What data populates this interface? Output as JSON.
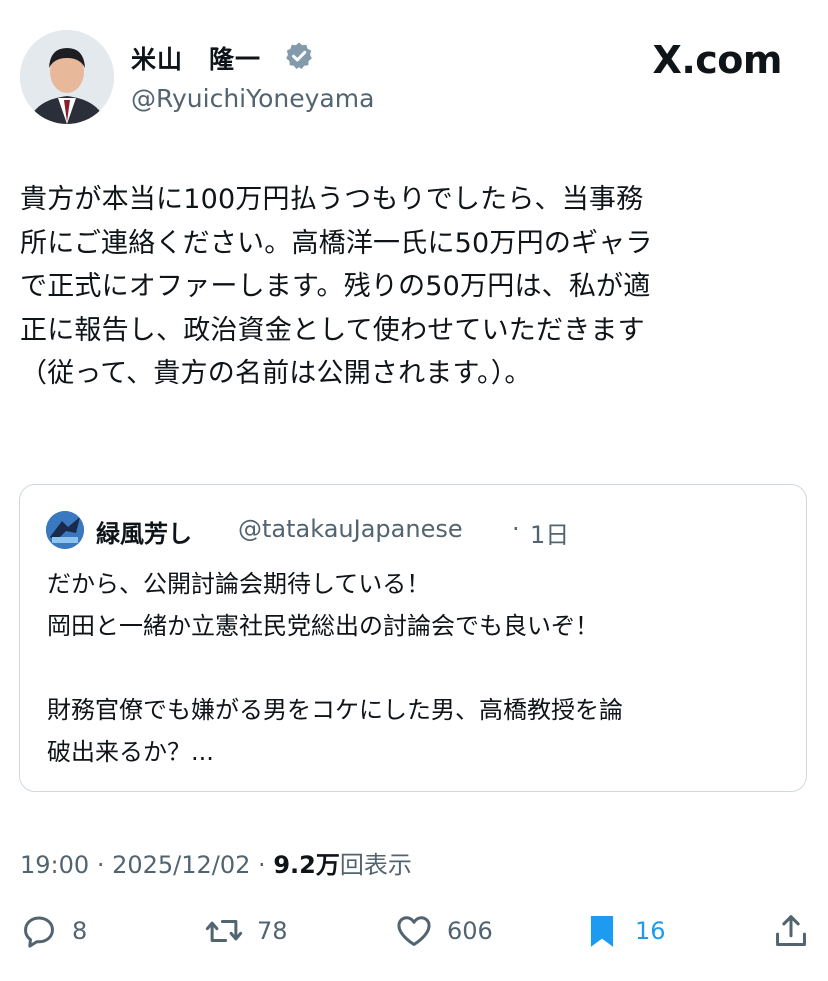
{
  "author": {
    "name": "米山　隆一",
    "handle": "@RyuichiYoneyama",
    "verified": true
  },
  "branding": {
    "site": "X.com"
  },
  "tweet": {
    "text": "貴方が本当に100万円払うつもりでしたら、当事務\n所にご連絡ください。高橋洋一氏に50万円のギャラ\nで正式にオファーします。残りの50万円は、私が適\n正に報告し、政治資金として使わせていただきます\n（従って、貴方の名前は公開されます。）。"
  },
  "quoted_tweet": {
    "name": "緑風芳し",
    "handle": "@tatakauJapanese",
    "time": "1日",
    "text": "だから、公開討論会期待している！\n岡田と一緒か立憲社民党総出の討論会でも良いぞ！\n\n財務官僚でも嫌がる男をコケにした男、高橋教授を論\n破出来るか？..."
  },
  "meta": {
    "time": "19:00",
    "date": "2025/12/02",
    "views": "9.2万",
    "views_label": "回表示"
  },
  "actions": {
    "replies": "8",
    "reposts": "78",
    "likes": "606",
    "bookmarks": "16"
  },
  "colors": {
    "text": "#0f1419",
    "secondary": "#536471",
    "accent": "#1d9bf0",
    "border": "#cfd9de"
  },
  "icons": {
    "reply": "reply-icon",
    "repost": "repost-icon",
    "like": "heart-icon",
    "bookmark": "bookmark-icon",
    "share": "share-icon",
    "verified": "verified-badge-icon"
  }
}
